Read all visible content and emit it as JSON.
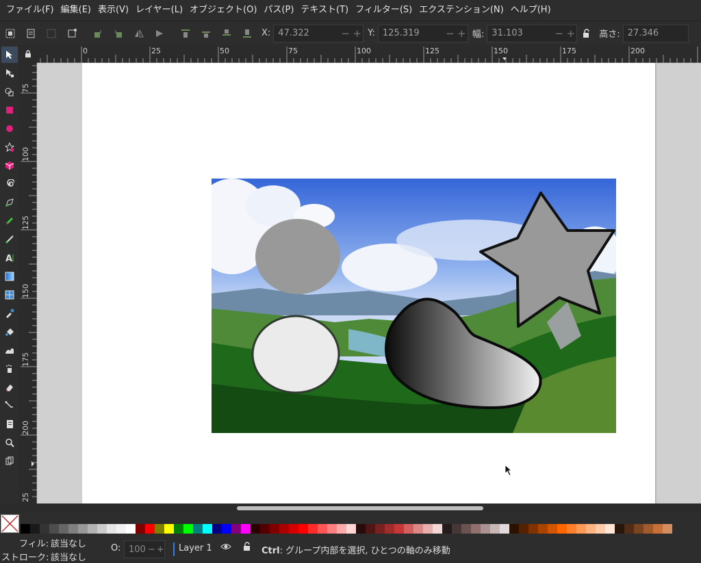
{
  "menubar": {
    "items": [
      "ファイル(F)",
      "編集(E)",
      "表示(V)",
      "レイヤー(L)",
      "オブジェクト(O)",
      "パス(P)",
      "テキスト(T)",
      "フィルター(S)",
      "エクステンション(N)",
      "ヘルプ(H)"
    ]
  },
  "toolctrl": {
    "x_label": "X:",
    "x_value": "47.322",
    "y_label": "Y:",
    "y_value": "125.319",
    "w_label": "幅:",
    "w_value": "31.103",
    "h_label": "高さ:",
    "h_value": "27.346"
  },
  "hruler": {
    "ticks": [
      "0",
      "25",
      "50",
      "75",
      "100",
      "125",
      "150",
      "175",
      "200"
    ]
  },
  "vruler": {
    "ticks": [
      "75",
      "100",
      "125",
      "150",
      "175",
      "200",
      "25"
    ]
  },
  "palette": {
    "colors": [
      "#000000",
      "#1a1a1a",
      "#333333",
      "#4d4d4d",
      "#666666",
      "#808080",
      "#999999",
      "#b3b3b3",
      "#cccccc",
      "#e6e6e6",
      "#f2f2f2",
      "#ffffff",
      "#800000",
      "#ff0000",
      "#808000",
      "#ffff00",
      "#008000",
      "#00ff00",
      "#008080",
      "#00ffff",
      "#000080",
      "#0000ff",
      "#800080",
      "#ff00ff",
      "#2b0000",
      "#550000",
      "#800000",
      "#aa0000",
      "#d40000",
      "#ff0000",
      "#ff2a2a",
      "#ff5555",
      "#ff8080",
      "#ffaaaa",
      "#ffd5d5",
      "#280b0b",
      "#501616",
      "#782121",
      "#a02c2c",
      "#c83737",
      "#d35f5f",
      "#de8787",
      "#e9afaf",
      "#f4d7d7",
      "#241c1c",
      "#483737",
      "#6c5353",
      "#916f6f",
      "#ac9393",
      "#c8b7b7",
      "#e3dbdb",
      "#2b1100",
      "#552200",
      "#803300",
      "#aa4400",
      "#d45500",
      "#ff6600",
      "#ff7f2a",
      "#ff9955",
      "#ffb380",
      "#ffccaa",
      "#ffe6d5",
      "#28170b",
      "#502d16",
      "#784421",
      "#a05a2c",
      "#c87137",
      "#d38d5f"
    ]
  },
  "status": {
    "fill_label": "フィル:",
    "fill_value": "該当なし",
    "stroke_label": "ストローク:",
    "stroke_value": "該当なし",
    "opacity_label": "O:",
    "opacity_value": "100",
    "layer_name": "Layer 1",
    "hint_key": "Ctrl",
    "hint_text": ": グループ内部を選択, ひとつの軸のみ移動"
  },
  "colors": {
    "accent": "#3a7bd5",
    "shape_gray": "#999999",
    "ellipse_light": "#ebebeb",
    "stroke": "#111111"
  }
}
